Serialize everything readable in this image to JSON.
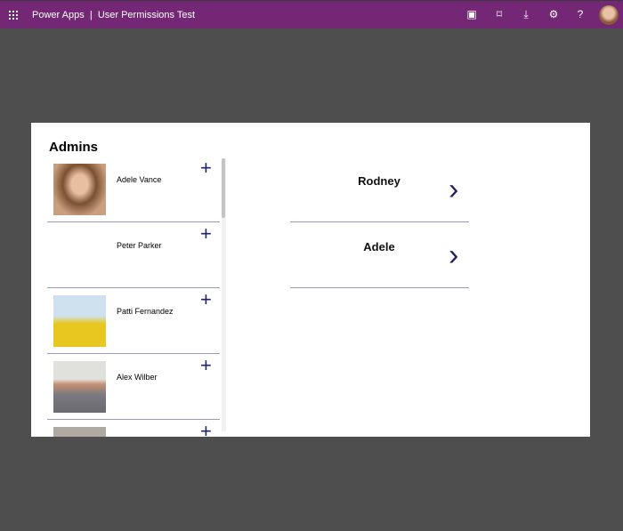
{
  "header": {
    "app_name": "Power Apps",
    "separator": "|",
    "app_title": "User Permissions Test",
    "icons": [
      "teams-icon",
      "fit-to-screen-icon",
      "download-icon",
      "settings-icon",
      "help-icon"
    ]
  },
  "canvas": {
    "heading": "Admins",
    "admins": [
      {
        "name": "Adele Vance",
        "photo": true
      },
      {
        "name": "Peter Parker",
        "photo": false
      },
      {
        "name": "Patti Fernandez",
        "photo": true
      },
      {
        "name": "Alex Wilber",
        "photo": true
      },
      {
        "name": "",
        "photo": true
      }
    ],
    "selected": [
      {
        "name": "Rodney"
      },
      {
        "name": "Adele"
      }
    ],
    "add_symbol": "+",
    "chevron_symbol": "〉"
  },
  "colors": {
    "brand": "#742774",
    "accent": "#222266"
  }
}
